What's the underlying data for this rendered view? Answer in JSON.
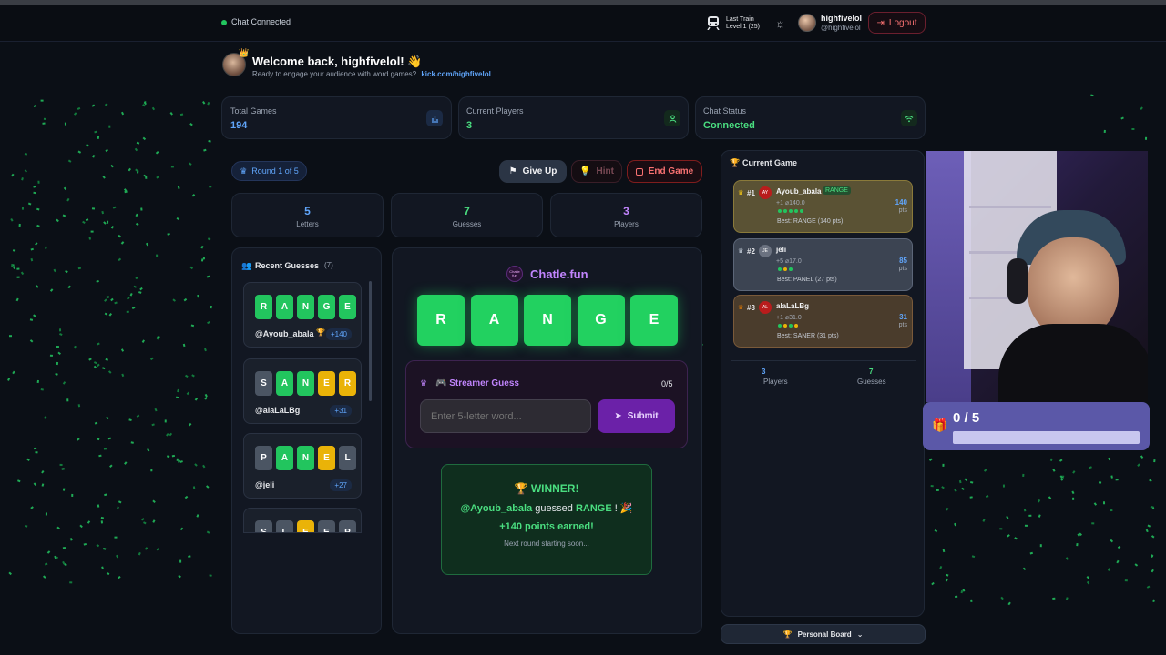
{
  "topbar": {
    "chat_status": "Chat Connected",
    "last_train_title": "Last Train",
    "last_train_level": "Level 1  (25)",
    "username": "highfivelol",
    "handle": "@highfivelol",
    "logout_label": "Logout"
  },
  "welcome": {
    "title": "Welcome back, highfivelol! 👋",
    "subtitle": "Ready to engage your audience with word games?",
    "link": "kick.com/highfivelol"
  },
  "stats": [
    {
      "label": "Total Games",
      "value": "194",
      "icon": "bar-chart-icon"
    },
    {
      "label": "Current Players",
      "value": "3",
      "icon": "user-icon"
    },
    {
      "label": "Chat Status",
      "value": "Connected",
      "icon": "wifi-icon"
    }
  ],
  "game": {
    "round_label": "Round 1 of 5",
    "give_up_label": "Give Up",
    "hint_label": "Hint",
    "end_game_label": "End Game",
    "counters": [
      {
        "value": "5",
        "label": "Letters"
      },
      {
        "value": "7",
        "label": "Guesses"
      },
      {
        "value": "3",
        "label": "Players"
      }
    ]
  },
  "recent_guesses": {
    "title": "Recent Guesses",
    "count": "(7)",
    "items": [
      {
        "letters": [
          "R",
          "A",
          "N",
          "G",
          "E"
        ],
        "states": [
          "g",
          "g",
          "g",
          "g",
          "g"
        ],
        "user": "@Ayoub_abala",
        "points": "+140",
        "winner": true
      },
      {
        "letters": [
          "S",
          "A",
          "N",
          "E",
          "R"
        ],
        "states": [
          "x",
          "g",
          "g",
          "y",
          "y"
        ],
        "user": "@alaLaLBg",
        "points": "+31",
        "winner": false
      },
      {
        "letters": [
          "P",
          "A",
          "N",
          "E",
          "L"
        ],
        "states": [
          "x",
          "g",
          "g",
          "y",
          "x"
        ],
        "user": "@jeli",
        "points": "+27",
        "winner": false
      },
      {
        "letters": [
          "S",
          "L",
          "E",
          "E",
          "P"
        ],
        "states": [
          "x",
          "x",
          "y",
          "x",
          "x"
        ],
        "user": "",
        "points": "",
        "winner": false
      }
    ]
  },
  "board": {
    "brand": "Chatle.fun",
    "brand_logo_text": "Chatle fun",
    "word": [
      "R",
      "A",
      "N",
      "G",
      "E"
    ],
    "streamer_guess_label": "🎮 Streamer Guess",
    "streamer_count": "0/5",
    "input_placeholder": "Enter 5-letter word...",
    "submit_label": "Submit",
    "winner_title": "WINNER!",
    "winner_user": "@Ayoub_abala",
    "winner_guessed": "guessed",
    "winner_word": "RANGE",
    "winner_emoji": "! 🎉",
    "winner_points": "+140 points earned!",
    "next_round": "Next round starting soon..."
  },
  "current_game": {
    "title": "Current Game",
    "players": [
      {
        "rank": "#1",
        "initials": "AY",
        "name": "Ayoub_abala",
        "tag": "RANGE",
        "stats": "+1 ⌀140.0",
        "best": "Best: RANGE (140 pts)",
        "points": "140",
        "pts_label": "pts",
        "dots": [
          "#22c55e",
          "#22c55e",
          "#22c55e",
          "#22c55e",
          "#22c55e"
        ]
      },
      {
        "rank": "#2",
        "initials": "JE",
        "name": "jeli",
        "tag": "",
        "stats": "+5 ⌀17.0",
        "best": "Best: PANEL (27 pts)",
        "points": "85",
        "pts_label": "pts",
        "dots": [
          "#22c55e",
          "#eab308",
          "#22c55e"
        ]
      },
      {
        "rank": "#3",
        "initials": "AL",
        "name": "alaLaLBg",
        "tag": "",
        "stats": "+1 ⌀31.0",
        "best": "Best: SANER (31 pts)",
        "points": "31",
        "pts_label": "pts",
        "dots": [
          "#22c55e",
          "#eab308",
          "#22c55e",
          "#eab308"
        ]
      }
    ],
    "footer": [
      {
        "value": "3",
        "label": "Players"
      },
      {
        "value": "7",
        "label": "Guesses"
      }
    ],
    "personal_board_label": "Personal Board"
  },
  "overlay": {
    "counter": "0 / 5",
    "progress": 0
  },
  "colors": {
    "accent_green": "#22c55e",
    "accent_purple": "#7e22ce",
    "accent_blue": "#60a5fa",
    "danger": "#f87171"
  }
}
